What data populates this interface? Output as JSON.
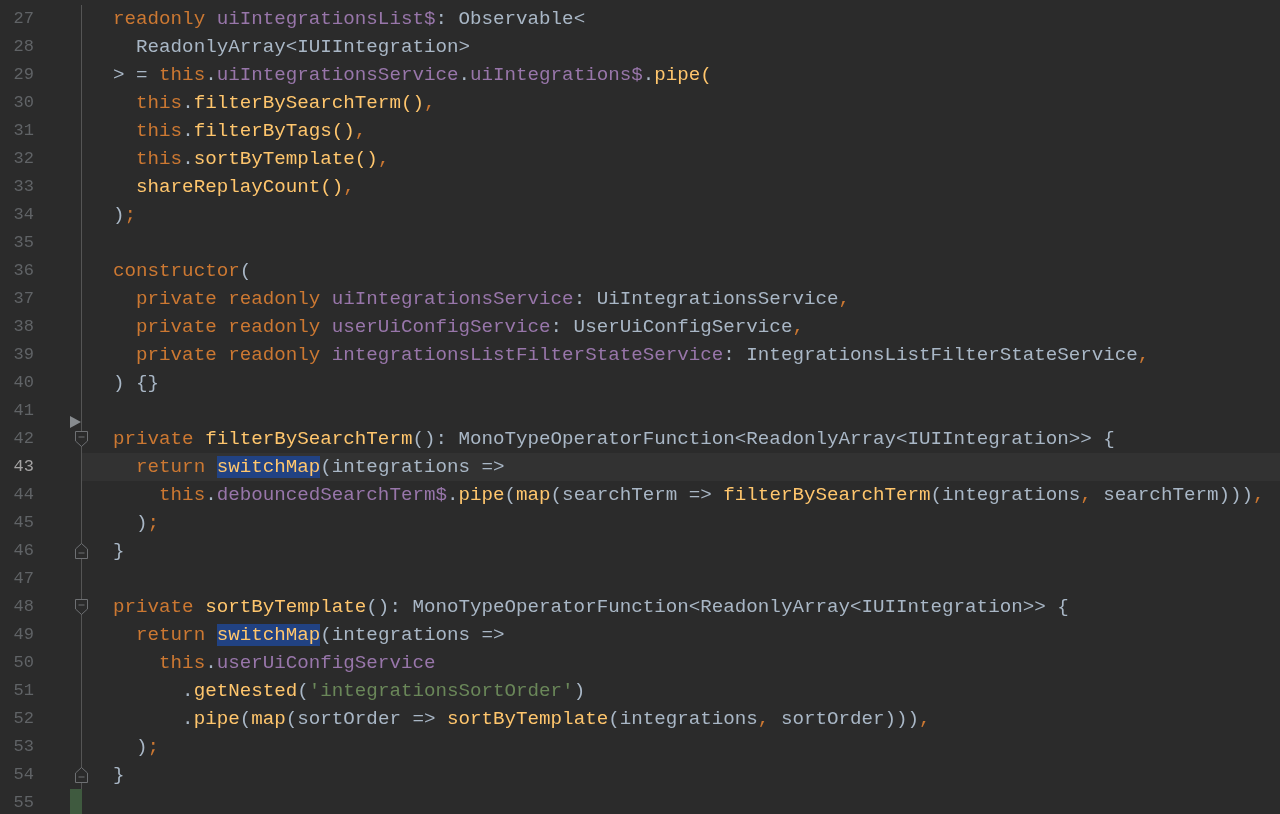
{
  "editor": {
    "lines": [
      {
        "number": "27",
        "current": false,
        "tokens": [
          {
            "text": "  readonly",
            "kind": "keyword"
          },
          {
            "text": " uiIntegrationsList$",
            "kind": "field"
          },
          {
            "text": ": Observable<",
            "kind": "plain"
          }
        ]
      },
      {
        "number": "28",
        "current": false,
        "tokens": [
          {
            "text": "    ReadonlyArray<IUIIntegration>",
            "kind": "plain"
          }
        ]
      },
      {
        "number": "29",
        "current": false,
        "tokens": [
          {
            "text": "  > = ",
            "kind": "plain"
          },
          {
            "text": "this",
            "kind": "keyword"
          },
          {
            "text": ".",
            "kind": "plain"
          },
          {
            "text": "uiIntegrationsService",
            "kind": "field"
          },
          {
            "text": ".",
            "kind": "plain"
          },
          {
            "text": "uiIntegrations$",
            "kind": "field"
          },
          {
            "text": ".",
            "kind": "plain"
          },
          {
            "text": "pipe(",
            "kind": "function"
          }
        ]
      },
      {
        "number": "30",
        "current": false,
        "tokens": [
          {
            "text": "    this",
            "kind": "keyword"
          },
          {
            "text": ".",
            "kind": "plain"
          },
          {
            "text": "filterBySearchTerm()",
            "kind": "function"
          },
          {
            "text": ",",
            "kind": "keyword"
          }
        ]
      },
      {
        "number": "31",
        "current": false,
        "tokens": [
          {
            "text": "    this",
            "kind": "keyword"
          },
          {
            "text": ".",
            "kind": "plain"
          },
          {
            "text": "filterByTags()",
            "kind": "function"
          },
          {
            "text": ",",
            "kind": "keyword"
          }
        ]
      },
      {
        "number": "32",
        "current": false,
        "tokens": [
          {
            "text": "    this",
            "kind": "keyword"
          },
          {
            "text": ".",
            "kind": "plain"
          },
          {
            "text": "sortByTemplate()",
            "kind": "function"
          },
          {
            "text": ",",
            "kind": "keyword"
          }
        ]
      },
      {
        "number": "33",
        "current": false,
        "tokens": [
          {
            "text": "    shareReplayCount()",
            "kind": "function"
          },
          {
            "text": ",",
            "kind": "keyword"
          }
        ]
      },
      {
        "number": "34",
        "current": false,
        "tokens": [
          {
            "text": "  )",
            "kind": "plain"
          },
          {
            "text": ";",
            "kind": "keyword"
          }
        ]
      },
      {
        "number": "35",
        "current": false
      },
      {
        "number": "36",
        "current": false,
        "tokens": [
          {
            "text": "  constructor",
            "kind": "keyword"
          },
          {
            "text": "(",
            "kind": "plain"
          }
        ]
      },
      {
        "number": "37",
        "current": false,
        "tokens": [
          {
            "text": "    private readonly",
            "kind": "keyword"
          },
          {
            "text": " uiIntegrationsService",
            "kind": "field"
          },
          {
            "text": ": UiIntegrationsService",
            "kind": "plain"
          },
          {
            "text": ",",
            "kind": "keyword"
          }
        ]
      },
      {
        "number": "38",
        "current": false,
        "tokens": [
          {
            "text": "    private readonly",
            "kind": "keyword"
          },
          {
            "text": " userUiConfigService",
            "kind": "field"
          },
          {
            "text": ": UserUiConfigService",
            "kind": "plain"
          },
          {
            "text": ",",
            "kind": "keyword"
          }
        ]
      },
      {
        "number": "39",
        "current": false,
        "tokens": [
          {
            "text": "    private readonly",
            "kind": "keyword"
          },
          {
            "text": " integrationsListFilterStateService",
            "kind": "field"
          },
          {
            "text": ": IntegrationsListFilterStateService",
            "kind": "plain"
          },
          {
            "text": ",",
            "kind": "keyword"
          }
        ]
      },
      {
        "number": "40",
        "current": false,
        "tokens": [
          {
            "text": "  ) {}",
            "kind": "plain"
          }
        ]
      },
      {
        "number": "41",
        "current": false
      },
      {
        "number": "42",
        "current": false,
        "gutter": [
          {
            "kind": "arrow"
          },
          {
            "kind": "fold-start"
          }
        ],
        "tokens": [
          {
            "text": "  private",
            "kind": "keyword"
          },
          {
            "text": " filterBySearchTerm",
            "kind": "function"
          },
          {
            "text": "(): MonoTypeOperatorFunction<ReadonlyArray<IUIIntegration>> {",
            "kind": "plain"
          }
        ]
      },
      {
        "number": "43",
        "current": true,
        "tokens": [
          {
            "text": "    return ",
            "kind": "keyword"
          },
          {
            "text": "switchMap",
            "kind": "usage"
          },
          {
            "text": "(integrations =>",
            "kind": "plain"
          }
        ]
      },
      {
        "number": "44",
        "current": false,
        "tokens": [
          {
            "text": "      this",
            "kind": "keyword"
          },
          {
            "text": ".",
            "kind": "plain"
          },
          {
            "text": "debouncedSearchTerm$",
            "kind": "field"
          },
          {
            "text": ".",
            "kind": "plain"
          },
          {
            "text": "pipe",
            "kind": "function"
          },
          {
            "text": "(",
            "kind": "plain"
          },
          {
            "text": "map",
            "kind": "function"
          },
          {
            "text": "(searchTerm => ",
            "kind": "plain"
          },
          {
            "text": "filterBySearchTerm",
            "kind": "function"
          },
          {
            "text": "(integrations",
            "kind": "plain"
          },
          {
            "text": ",",
            "kind": "keyword"
          },
          {
            "text": " searchTerm)))",
            "kind": "plain"
          },
          {
            "text": ",",
            "kind": "keyword"
          }
        ]
      },
      {
        "number": "45",
        "current": false,
        "tokens": [
          {
            "text": "    )",
            "kind": "plain"
          },
          {
            "text": ";",
            "kind": "keyword"
          }
        ]
      },
      {
        "number": "46",
        "current": false,
        "gutter": [
          {
            "kind": "fold-end"
          }
        ],
        "tokens": [
          {
            "text": "  }",
            "kind": "plain"
          }
        ]
      },
      {
        "number": "47",
        "current": false
      },
      {
        "number": "48",
        "current": false,
        "gutter": [
          {
            "kind": "fold-start"
          }
        ],
        "tokens": [
          {
            "text": "  private",
            "kind": "keyword"
          },
          {
            "text": " sortByTemplate",
            "kind": "function"
          },
          {
            "text": "(): MonoTypeOperatorFunction<ReadonlyArray<IUIIntegration>> {",
            "kind": "plain"
          }
        ]
      },
      {
        "number": "49",
        "current": false,
        "tokens": [
          {
            "text": "    return ",
            "kind": "keyword"
          },
          {
            "text": "switchMap",
            "kind": "usage"
          },
          {
            "text": "(integrations =>",
            "kind": "plain"
          }
        ]
      },
      {
        "number": "50",
        "current": false,
        "tokens": [
          {
            "text": "      this",
            "kind": "keyword"
          },
          {
            "text": ".",
            "kind": "plain"
          },
          {
            "text": "userUiConfigService",
            "kind": "field"
          }
        ]
      },
      {
        "number": "51",
        "current": false,
        "tokens": [
          {
            "text": "        .",
            "kind": "plain"
          },
          {
            "text": "getNested",
            "kind": "function"
          },
          {
            "text": "(",
            "kind": "plain"
          },
          {
            "text": "'integrationsSortOrder'",
            "kind": "string"
          },
          {
            "text": ")",
            "kind": "plain"
          }
        ]
      },
      {
        "number": "52",
        "current": false,
        "tokens": [
          {
            "text": "        .",
            "kind": "plain"
          },
          {
            "text": "pipe",
            "kind": "function"
          },
          {
            "text": "(",
            "kind": "plain"
          },
          {
            "text": "map",
            "kind": "function"
          },
          {
            "text": "(sortOrder => ",
            "kind": "plain"
          },
          {
            "text": "sortByTemplate",
            "kind": "function"
          },
          {
            "text": "(integrations",
            "kind": "plain"
          },
          {
            "text": ",",
            "kind": "keyword"
          },
          {
            "text": " sortOrder)))",
            "kind": "plain"
          },
          {
            "text": ",",
            "kind": "keyword"
          }
        ]
      },
      {
        "number": "53",
        "current": false,
        "tokens": [
          {
            "text": "    )",
            "kind": "plain"
          },
          {
            "text": ";",
            "kind": "keyword"
          }
        ]
      },
      {
        "number": "54",
        "current": false,
        "gutter": [
          {
            "kind": "fold-end"
          }
        ],
        "tokens": [
          {
            "text": "  }",
            "kind": "plain"
          }
        ]
      },
      {
        "number": "55",
        "current": false,
        "gutter": [
          {
            "kind": "changed"
          }
        ]
      }
    ]
  }
}
